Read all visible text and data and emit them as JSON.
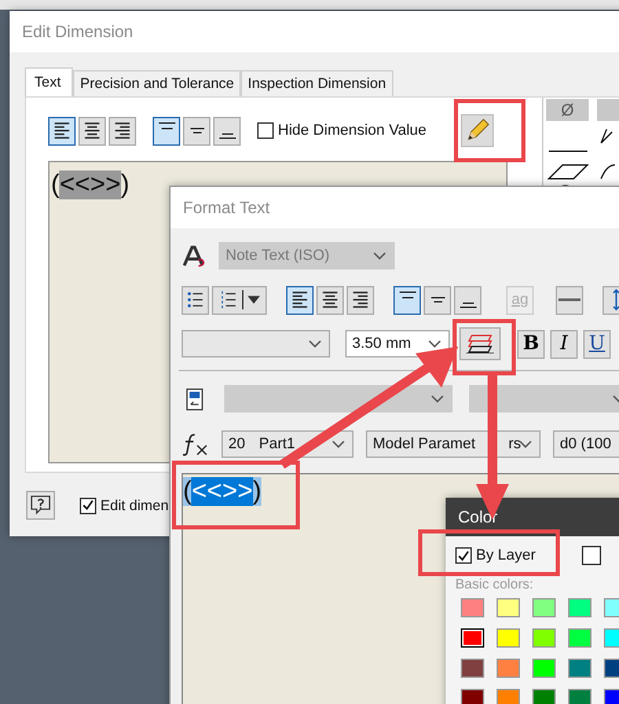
{
  "edit_dimension": {
    "title": "Edit Dimension",
    "tabs": [
      {
        "label": "Text",
        "selected": true
      },
      {
        "label": "Precision and Tolerance",
        "selected": false
      },
      {
        "label": "Inspection Dimension",
        "selected": false
      }
    ],
    "justify_buttons": [
      {
        "kind": "align-left",
        "selected": true
      },
      {
        "kind": "align-center",
        "selected": false
      },
      {
        "kind": "align-right",
        "selected": false
      }
    ],
    "vertical_buttons": [
      {
        "kind": "valign-top",
        "selected": true
      },
      {
        "kind": "valign-middle",
        "selected": false
      },
      {
        "kind": "valign-bottom",
        "selected": false
      }
    ],
    "hide_dimension_value": {
      "label": "Hide Dimension Value",
      "checked": false
    },
    "editor": {
      "before": "(",
      "highlighted": "<<>>",
      "after": ")"
    },
    "palette": [
      {
        "label": "Ø"
      }
    ],
    "edit_checkbox": {
      "label": "Edit dimen",
      "checked": true
    }
  },
  "format_text": {
    "title": "Format Text",
    "style": "Note Text (ISO)",
    "list_buttons": [
      {
        "kind": "bullets",
        "selected": false
      },
      {
        "kind": "numbering",
        "selected": false
      }
    ],
    "justify_buttons": [
      {
        "kind": "align-left",
        "selected": true
      },
      {
        "kind": "align-center",
        "selected": false
      },
      {
        "kind": "align-right",
        "selected": false
      }
    ],
    "vertical_buttons": [
      {
        "kind": "valign-top",
        "selected": true
      },
      {
        "kind": "valign-middle",
        "selected": false
      },
      {
        "kind": "valign-bottom",
        "selected": false
      }
    ],
    "stack_button": "ag",
    "font_size": "3.50 mm",
    "style_buttons": [
      "B",
      "I",
      "U"
    ],
    "parameter_combos": [
      {
        "value": "20"
      },
      {
        "value": "Model Paramet",
        "value_end": "rs"
      },
      {
        "value": "d0 (100"
      }
    ],
    "part_suffix": "Part1",
    "editor": {
      "before": "(",
      "selected": "<<>>",
      "after": ")"
    }
  },
  "color_dialog": {
    "title": "Color",
    "by_layer": {
      "label": "By Layer",
      "checked": true
    },
    "basic_colors_label": "Basic colors:",
    "swatches": [
      {
        "color": "#ff8080",
        "selected": false
      },
      {
        "color": "#ffff80",
        "selected": false
      },
      {
        "color": "#80ff80",
        "selected": false
      },
      {
        "color": "#00ff80",
        "selected": false
      },
      {
        "color": "#80ffff",
        "selected": false
      },
      {
        "color": "#ff0000",
        "selected": true
      },
      {
        "color": "#ffff00",
        "selected": false
      },
      {
        "color": "#80ff00",
        "selected": false
      },
      {
        "color": "#00ff40",
        "selected": false
      },
      {
        "color": "#00ffff",
        "selected": false
      },
      {
        "color": "#804040",
        "selected": false
      },
      {
        "color": "#ff8040",
        "selected": false
      },
      {
        "color": "#00ff00",
        "selected": false
      },
      {
        "color": "#008080",
        "selected": false
      },
      {
        "color": "#004080",
        "selected": false
      },
      {
        "color": "#800000",
        "selected": false
      },
      {
        "color": "#ff8000",
        "selected": false
      },
      {
        "color": "#008000",
        "selected": false
      },
      {
        "color": "#008040",
        "selected": false
      },
      {
        "color": "#0000ff",
        "selected": false
      }
    ]
  }
}
